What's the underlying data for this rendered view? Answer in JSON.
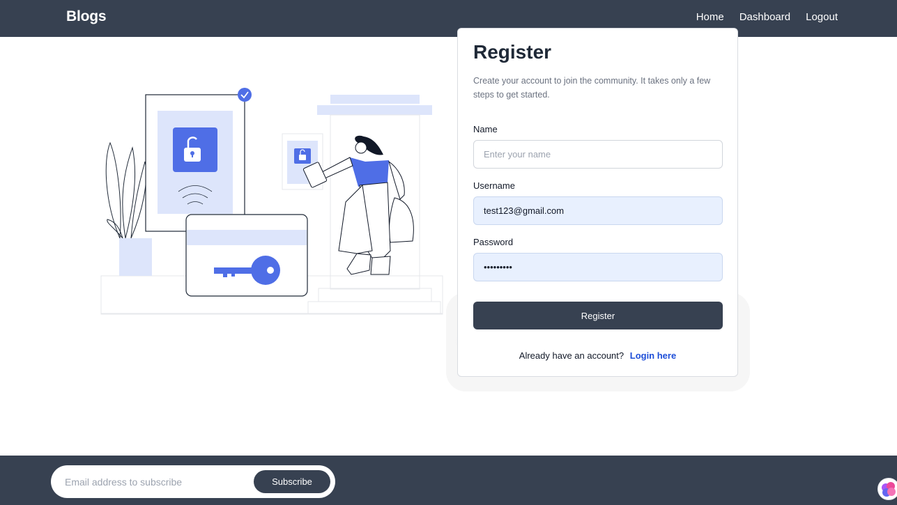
{
  "navbar": {
    "brand": "Blogs",
    "links": [
      "Home",
      "Dashboard",
      "Logout"
    ]
  },
  "register": {
    "title": "Register",
    "description": "Create your account to join the community. It takes only a few steps to get started.",
    "fields": {
      "name": {
        "label": "Name",
        "placeholder": "Enter your name",
        "value": ""
      },
      "username": {
        "label": "Username",
        "value": "test123@gmail.com"
      },
      "password": {
        "label": "Password",
        "value": "•••••••••"
      }
    },
    "submit_label": "Register",
    "login_prompt": "Already have an account?",
    "login_link": "Login here"
  },
  "footer": {
    "subscribe_placeholder": "Email address to subscribe",
    "subscribe_label": "Subscribe"
  },
  "colors": {
    "nav_bg": "#374151",
    "accent_blue": "#4f6ee6",
    "link_blue": "#1d4ed8",
    "input_filled": "#e8f0fe"
  },
  "icons": {
    "illustration": "register-illustration",
    "lock": "unlock-icon",
    "check": "check-badge-icon",
    "key": "key-icon",
    "widget": "brain-icon"
  }
}
